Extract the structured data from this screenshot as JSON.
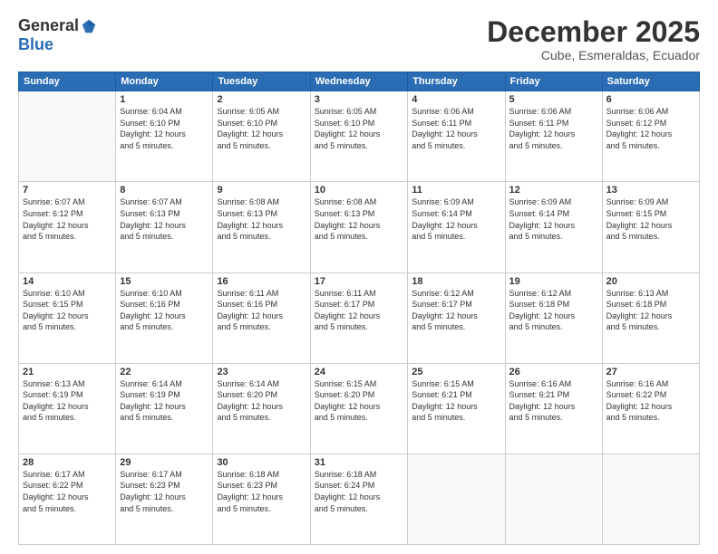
{
  "logo": {
    "general": "General",
    "blue": "Blue"
  },
  "title": "December 2025",
  "subtitle": "Cube, Esmeraldas, Ecuador",
  "days_header": [
    "Sunday",
    "Monday",
    "Tuesday",
    "Wednesday",
    "Thursday",
    "Friday",
    "Saturday"
  ],
  "weeks": [
    [
      {
        "day": "",
        "info": ""
      },
      {
        "day": "1",
        "info": "Sunrise: 6:04 AM\nSunset: 6:10 PM\nDaylight: 12 hours\nand 5 minutes."
      },
      {
        "day": "2",
        "info": "Sunrise: 6:05 AM\nSunset: 6:10 PM\nDaylight: 12 hours\nand 5 minutes."
      },
      {
        "day": "3",
        "info": "Sunrise: 6:05 AM\nSunset: 6:10 PM\nDaylight: 12 hours\nand 5 minutes."
      },
      {
        "day": "4",
        "info": "Sunrise: 6:06 AM\nSunset: 6:11 PM\nDaylight: 12 hours\nand 5 minutes."
      },
      {
        "day": "5",
        "info": "Sunrise: 6:06 AM\nSunset: 6:11 PM\nDaylight: 12 hours\nand 5 minutes."
      },
      {
        "day": "6",
        "info": "Sunrise: 6:06 AM\nSunset: 6:12 PM\nDaylight: 12 hours\nand 5 minutes."
      }
    ],
    [
      {
        "day": "7",
        "info": "Sunrise: 6:07 AM\nSunset: 6:12 PM\nDaylight: 12 hours\nand 5 minutes."
      },
      {
        "day": "8",
        "info": "Sunrise: 6:07 AM\nSunset: 6:13 PM\nDaylight: 12 hours\nand 5 minutes."
      },
      {
        "day": "9",
        "info": "Sunrise: 6:08 AM\nSunset: 6:13 PM\nDaylight: 12 hours\nand 5 minutes."
      },
      {
        "day": "10",
        "info": "Sunrise: 6:08 AM\nSunset: 6:13 PM\nDaylight: 12 hours\nand 5 minutes."
      },
      {
        "day": "11",
        "info": "Sunrise: 6:09 AM\nSunset: 6:14 PM\nDaylight: 12 hours\nand 5 minutes."
      },
      {
        "day": "12",
        "info": "Sunrise: 6:09 AM\nSunset: 6:14 PM\nDaylight: 12 hours\nand 5 minutes."
      },
      {
        "day": "13",
        "info": "Sunrise: 6:09 AM\nSunset: 6:15 PM\nDaylight: 12 hours\nand 5 minutes."
      }
    ],
    [
      {
        "day": "14",
        "info": "Sunrise: 6:10 AM\nSunset: 6:15 PM\nDaylight: 12 hours\nand 5 minutes."
      },
      {
        "day": "15",
        "info": "Sunrise: 6:10 AM\nSunset: 6:16 PM\nDaylight: 12 hours\nand 5 minutes."
      },
      {
        "day": "16",
        "info": "Sunrise: 6:11 AM\nSunset: 6:16 PM\nDaylight: 12 hours\nand 5 minutes."
      },
      {
        "day": "17",
        "info": "Sunrise: 6:11 AM\nSunset: 6:17 PM\nDaylight: 12 hours\nand 5 minutes."
      },
      {
        "day": "18",
        "info": "Sunrise: 6:12 AM\nSunset: 6:17 PM\nDaylight: 12 hours\nand 5 minutes."
      },
      {
        "day": "19",
        "info": "Sunrise: 6:12 AM\nSunset: 6:18 PM\nDaylight: 12 hours\nand 5 minutes."
      },
      {
        "day": "20",
        "info": "Sunrise: 6:13 AM\nSunset: 6:18 PM\nDaylight: 12 hours\nand 5 minutes."
      }
    ],
    [
      {
        "day": "21",
        "info": "Sunrise: 6:13 AM\nSunset: 6:19 PM\nDaylight: 12 hours\nand 5 minutes."
      },
      {
        "day": "22",
        "info": "Sunrise: 6:14 AM\nSunset: 6:19 PM\nDaylight: 12 hours\nand 5 minutes."
      },
      {
        "day": "23",
        "info": "Sunrise: 6:14 AM\nSunset: 6:20 PM\nDaylight: 12 hours\nand 5 minutes."
      },
      {
        "day": "24",
        "info": "Sunrise: 6:15 AM\nSunset: 6:20 PM\nDaylight: 12 hours\nand 5 minutes."
      },
      {
        "day": "25",
        "info": "Sunrise: 6:15 AM\nSunset: 6:21 PM\nDaylight: 12 hours\nand 5 minutes."
      },
      {
        "day": "26",
        "info": "Sunrise: 6:16 AM\nSunset: 6:21 PM\nDaylight: 12 hours\nand 5 minutes."
      },
      {
        "day": "27",
        "info": "Sunrise: 6:16 AM\nSunset: 6:22 PM\nDaylight: 12 hours\nand 5 minutes."
      }
    ],
    [
      {
        "day": "28",
        "info": "Sunrise: 6:17 AM\nSunset: 6:22 PM\nDaylight: 12 hours\nand 5 minutes."
      },
      {
        "day": "29",
        "info": "Sunrise: 6:17 AM\nSunset: 6:23 PM\nDaylight: 12 hours\nand 5 minutes."
      },
      {
        "day": "30",
        "info": "Sunrise: 6:18 AM\nSunset: 6:23 PM\nDaylight: 12 hours\nand 5 minutes."
      },
      {
        "day": "31",
        "info": "Sunrise: 6:18 AM\nSunset: 6:24 PM\nDaylight: 12 hours\nand 5 minutes."
      },
      {
        "day": "",
        "info": ""
      },
      {
        "day": "",
        "info": ""
      },
      {
        "day": "",
        "info": ""
      }
    ]
  ]
}
